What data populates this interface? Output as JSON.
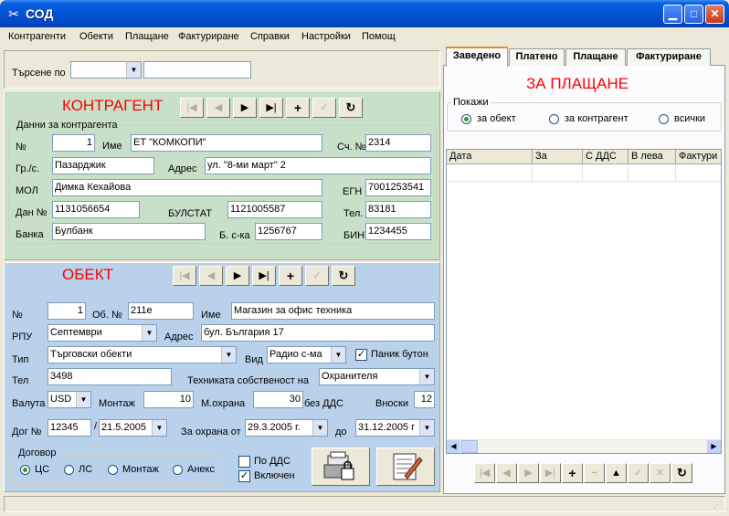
{
  "window": {
    "title": "СОД"
  },
  "menu": [
    "Контрагенти",
    "Обекти",
    "Плащане",
    "Фактуриране",
    "Справки",
    "Настройки",
    "Помощ"
  ],
  "search": {
    "label": "Търсене по",
    "select_value": "",
    "text_value": ""
  },
  "kontragent": {
    "heading": "КОНТРАГЕНТ",
    "group_title": "Данни за контрагента",
    "labels": {
      "no": "№",
      "name": "Име",
      "acc": "Сч. №",
      "city": "Гр./с.",
      "address": "Адрес",
      "mol": "МОЛ",
      "egn": "ЕГН",
      "tax": "Дан №",
      "bulstat": "БУЛСТАТ",
      "tel": "Тел.",
      "bank": "Банка",
      "bacc": "Б. с-ка",
      "bin": "БИН"
    },
    "values": {
      "no": "1",
      "name": "ЕТ \"КОМКОПИ\"",
      "acc": "2314",
      "city": "Пазарджик",
      "address": "ул. \"8-ми март\" 2",
      "mol": "Димка Кехайова",
      "egn": "7001253541",
      "tax": "1131056654",
      "bulstat": "1121005587",
      "tel": "83181",
      "bank": "Булбанк",
      "bacc": "1256767",
      "bin": "1234455"
    }
  },
  "obekt": {
    "heading": "ОБЕКТ",
    "labels": {
      "no": "№",
      "obno": "Об. №",
      "name": "Име",
      "rpu": "РПУ",
      "address": "Адрес",
      "type": "Тип",
      "kind": "Вид",
      "panic": "Паник бутон",
      "tel": "Тел",
      "owner": "Техниката собственост на",
      "currency": "Валута",
      "install": "Монтаж",
      "mguard": "М.охрана",
      "novat": "без ДДС",
      "payments": "Вноски",
      "contract_no": "Дог №",
      "guard_from": "За охрана от",
      "to": "до",
      "slash": "/"
    },
    "values": {
      "no": "1",
      "obno": "211е",
      "name": "Магазин за офис техника",
      "rpu": "Септември",
      "address": "бул. България 17",
      "type": "Търговски обекти",
      "kind": "Радио с-ма",
      "tel": "3498",
      "owner": "Охранителя",
      "currency": "USD",
      "install": "10",
      "mguard": "30",
      "payments": "12",
      "contract_no": "12345",
      "contract_date": "21.5.2005",
      "guard_from": "29.3.2005 г.",
      "guard_to": "31.12.2005 г"
    },
    "panic_checked": true,
    "contract_group": {
      "title": "Договор",
      "options": [
        "ЦС",
        "ЛС",
        "Монтаж",
        "Анекс"
      ],
      "selected": "ЦС"
    },
    "vat_label": "По ДДС",
    "vat_checked": false,
    "included_label": "Включен",
    "included_checked": true
  },
  "tabs": [
    "Заведено",
    "Платено",
    "Плащане",
    "Фактуриране"
  ],
  "active_tab": "Заведено",
  "right": {
    "heading": "ЗА ПЛАЩАНЕ",
    "show_group": {
      "title": "Покажи",
      "options": [
        "за обект",
        "за контрагент",
        "всички"
      ],
      "selected": "за обект"
    },
    "columns": [
      "Дата",
      "За",
      "С ДДС",
      "В лева",
      "Фактури"
    ]
  },
  "icons": {
    "nav": [
      "first-icon",
      "prev-icon",
      "next-icon",
      "last-icon",
      "add-icon",
      "confirm-icon",
      "refresh-icon"
    ],
    "bottom_nav": [
      "first-icon",
      "prev-icon",
      "next-icon",
      "last-icon",
      "add-icon",
      "minus-icon",
      "up-icon",
      "confirm-icon",
      "cancel-icon",
      "refresh-icon"
    ]
  },
  "colors": {
    "accent_red": "#ff0000",
    "kontragent_bg": "#c8e0c8",
    "obekt_bg": "#b9d1ea"
  }
}
